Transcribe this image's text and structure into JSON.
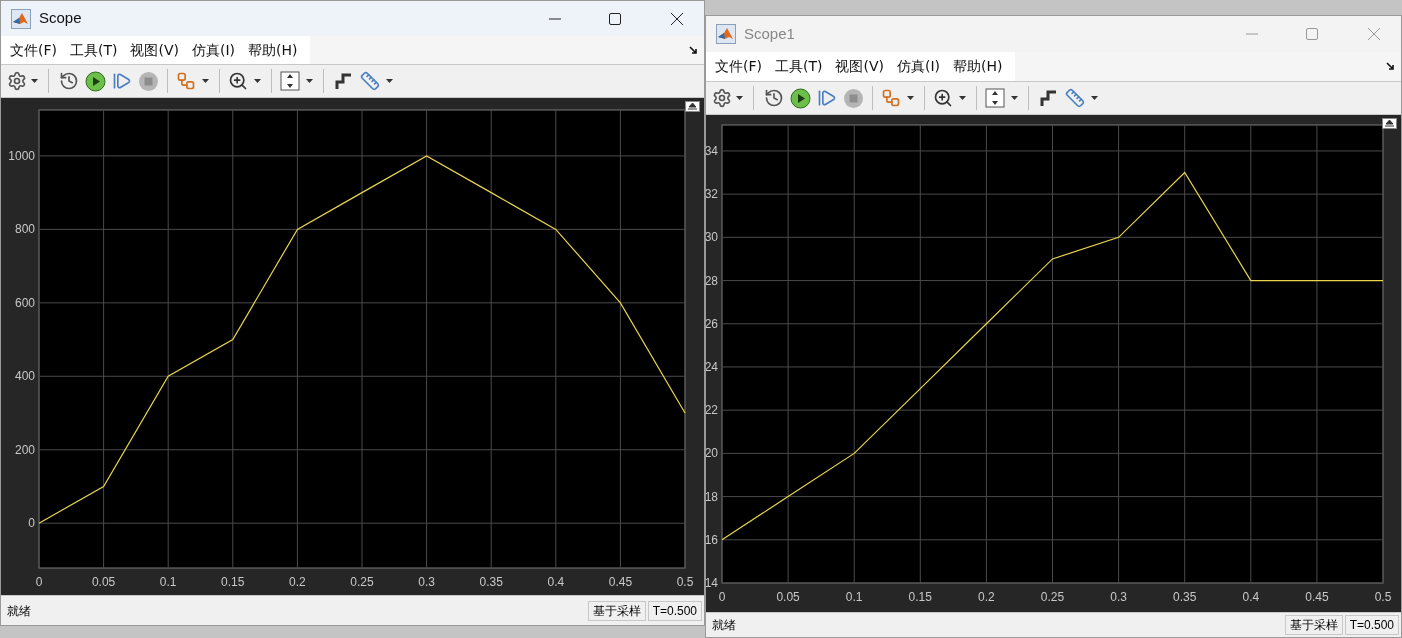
{
  "windows": [
    {
      "title": "Scope",
      "active": true,
      "menu": [
        "文件(F)",
        "工具(T)",
        "视图(V)",
        "仿真(I)",
        "帮助(H)"
      ],
      "chart_data": {
        "type": "line",
        "x": [
          0,
          0.05,
          0.1,
          0.15,
          0.2,
          0.25,
          0.3,
          0.35,
          0.4,
          0.45,
          0.5
        ],
        "series": [
          {
            "color": "#e8d44d",
            "values": [
              0,
              100,
              400,
              500,
              800,
              900,
              1000,
              900,
              800,
              600,
              300
            ]
          }
        ],
        "xlim": [
          0,
          0.5
        ],
        "ylim": [
          -122,
          1125
        ],
        "xticks": [
          0,
          0.05,
          0.1,
          0.15,
          0.2,
          0.25,
          0.3,
          0.35,
          0.4,
          0.45,
          0.5
        ],
        "yticks": [
          0,
          200,
          400,
          600,
          800,
          1000
        ],
        "grid": true
      },
      "status_bar": {
        "state": "就绪",
        "mode": "基于采样",
        "time": "T=0.500"
      }
    },
    {
      "title": "Scope1",
      "active": false,
      "menu": [
        "文件(F)",
        "工具(T)",
        "视图(V)",
        "仿真(I)",
        "帮助(H)"
      ],
      "chart_data": {
        "type": "line",
        "x": [
          0,
          0.05,
          0.1,
          0.15,
          0.2,
          0.25,
          0.3,
          0.35,
          0.4,
          0.45,
          0.5
        ],
        "series": [
          {
            "color": "#e8d44d",
            "values": [
              16,
              18,
              20,
              23,
              26,
              29,
              30,
              33,
              28,
              28,
              28
            ]
          }
        ],
        "xlim": [
          0,
          0.5
        ],
        "ylim": [
          14,
          35.2
        ],
        "xticks": [
          0,
          0.05,
          0.1,
          0.15,
          0.2,
          0.25,
          0.3,
          0.35,
          0.4,
          0.45,
          0.5
        ],
        "yticks": [
          14,
          16,
          18,
          20,
          22,
          24,
          26,
          28,
          30,
          32,
          34
        ],
        "grid": true
      },
      "status_bar": {
        "state": "就绪",
        "mode": "基于采样",
        "time": "T=0.500"
      }
    }
  ]
}
